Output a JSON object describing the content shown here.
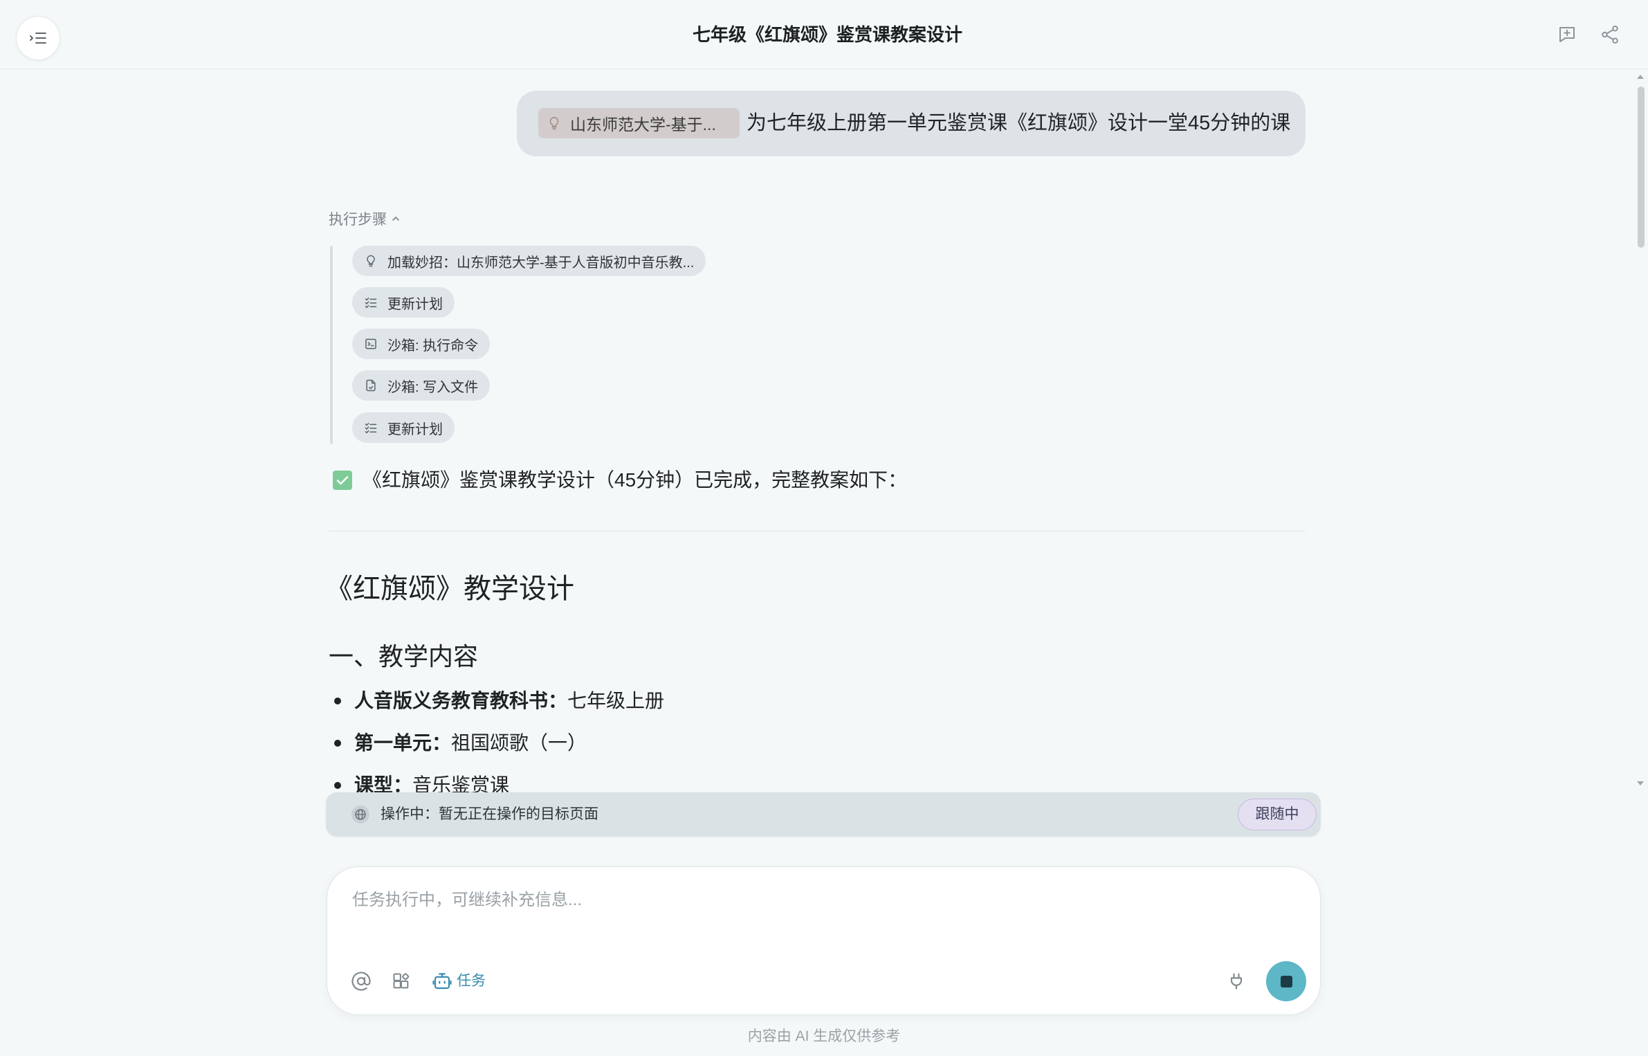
{
  "header": {
    "title": "七年级《红旗颂》鉴赏课教案设计",
    "sidebar_toggle_icon": "sidebar-toggle-icon",
    "new_chat_icon": "new-chat-icon",
    "share_icon": "share-icon"
  },
  "user_message": {
    "attachment_chip": {
      "icon": "bulb-icon",
      "label": "山东师范大学-基于..."
    },
    "text": "为七年级上册第一单元鉴赏课《红旗颂》设计一堂45分钟的课"
  },
  "steps": {
    "toggle_label": "执行步骤",
    "toggle_icon": "chevron-up-icon",
    "expanded": true,
    "items": [
      {
        "icon": "bulb-icon",
        "label": "加载妙招：山东师范大学-基于人音版初中音乐教..."
      },
      {
        "icon": "checklist-icon",
        "label": "更新计划"
      },
      {
        "icon": "terminal-icon",
        "label": "沙箱: 执行命令"
      },
      {
        "icon": "file-write-icon",
        "label": "沙箱: 写入文件"
      },
      {
        "icon": "checklist-icon",
        "label": "更新计划"
      }
    ]
  },
  "answer": {
    "status_icon": "check-box-icon",
    "summary": "《红旗颂》鉴赏课教学设计（45分钟）已完成，完整教案如下：",
    "doc_title": "《红旗颂》教学设计",
    "section_title": "一、教学内容",
    "bullets": [
      {
        "label": "人音版义务教育教科书：",
        "value": "七年级上册"
      },
      {
        "label": "第一单元：",
        "value": "祖国颂歌（一）"
      },
      {
        "label": "课型：",
        "value": "音乐鉴赏课"
      }
    ]
  },
  "operation_bar": {
    "icon": "globe-icon",
    "status": "操作中：暂无正在操作的目标页面",
    "follow_label": "跟随中"
  },
  "composer": {
    "placeholder": "任务执行中，可继续补充信息...",
    "value": "",
    "mode_label": "任务",
    "tools": [
      "at-mention-icon",
      "apps-icon",
      "robot-icon",
      "plug-icon",
      "stop-icon"
    ]
  },
  "footer": {
    "disclaimer": "内容由 AI 生成仅供参考"
  },
  "colors": {
    "page_bg": "#f4f8f9",
    "bubble_bg": "#dde3e6",
    "chip_bg": "#dfe5e8",
    "attachment_bg": "#d2cdcc",
    "accent": "#5db7c7",
    "task_blue": "#3a8cae",
    "follow_bg": "#e4e0f2",
    "follow_border": "#c4bce0",
    "success_green": "#7fcb98"
  }
}
